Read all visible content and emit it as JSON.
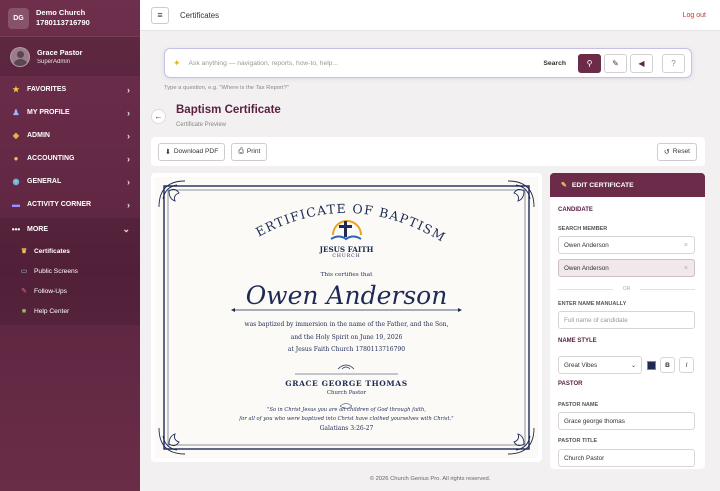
{
  "brand": {
    "initials": "DG",
    "name": "Demo Church",
    "id": "1780113716790"
  },
  "user": {
    "name": "Grace Pastor",
    "role": "SuperAdmin"
  },
  "nav": [
    {
      "icon": "star-icon",
      "glyph": "★",
      "color": "#f5c542",
      "label": "FAVORITES"
    },
    {
      "icon": "user-icon",
      "glyph": "👤",
      "color": "#9ab4ff",
      "label": "MY PROFILE"
    },
    {
      "icon": "admin-icon",
      "glyph": "🛡",
      "color": "#e8b04a",
      "label": "ADMIN"
    },
    {
      "icon": "money-bag-icon",
      "glyph": "💰",
      "color": "#f0c05a",
      "label": "ACCOUNTING"
    },
    {
      "icon": "globe-icon",
      "glyph": "🌐",
      "color": "#7fc3e8",
      "label": "GENERAL"
    },
    {
      "icon": "activity-icon",
      "glyph": "⚡",
      "color": "#9b8cff",
      "label": "ACTIVITY CORNER"
    }
  ],
  "more": {
    "label": "MORE",
    "items": [
      {
        "icon": "trophy-icon",
        "glyph": "🏆",
        "label": "Certificates"
      },
      {
        "icon": "screen-icon",
        "glyph": "🖥",
        "label": "Public Screens"
      },
      {
        "icon": "pin-icon",
        "glyph": "📌",
        "label": "Follow-Ups"
      },
      {
        "icon": "help-icon",
        "glyph": "📗",
        "label": "Help Center"
      }
    ]
  },
  "topbar": {
    "title": "Certificates",
    "logout": "Log out"
  },
  "search": {
    "placeholder": "Ask anything — navigation, reports, how-to, help...",
    "label": "Search",
    "hint": "Type a question, e.g. \"Where is the Tax Report?\""
  },
  "page": {
    "title": "Baptism Certificate",
    "subtitle": "Certificate Preview"
  },
  "toolbar": {
    "download": "Download PDF",
    "print": "Print",
    "reset": "Reset"
  },
  "certificate": {
    "heading": "CERTIFICATE OF BAPTISM",
    "church_logo_line1": "JESUS FAITH",
    "church_logo_line2": "CHURCH",
    "certifies": "This certifies that",
    "name": "Owen Anderson",
    "line1": "was baptized by immersion in the name of the Father, and the Son,",
    "line2": "and the Holy Spirit on June 19, 2026",
    "line3": "at Jesus Faith Church 1780113716790",
    "pastor_name": "GRACE GEORGE THOMAS",
    "pastor_title": "Church Pastor",
    "verse1": "\"So in Christ Jesus you are all children of God through faith,",
    "verse2": "for all of you who were baptized into Christ have clothed yourselves with Christ.\"",
    "reference": "Galatians 3:26-27",
    "ink_color": "#1e2a55"
  },
  "edit": {
    "header": "EDIT CERTIFICATE",
    "candidate_section": "CANDIDATE",
    "search_member_label": "SEARCH MEMBER",
    "search_member_value": "Owen Anderson",
    "selected_member": "Owen Anderson",
    "or": "OR",
    "manual_label": "ENTER NAME MANUALLY",
    "manual_placeholder": "Full name of candidate",
    "name_style_section": "NAME STYLE",
    "font_value": "Great Vibes",
    "bold": "B",
    "italic": "I",
    "pastor_section": "PASTOR",
    "pastor_name_label": "PASTOR NAME",
    "pastor_name_value": "Grace george thomas",
    "pastor_title_label": "PASTOR TITLE",
    "pastor_title_value": "Church Pastor"
  },
  "footer": "© 2026 Church Genius Pro. All rights reserved."
}
